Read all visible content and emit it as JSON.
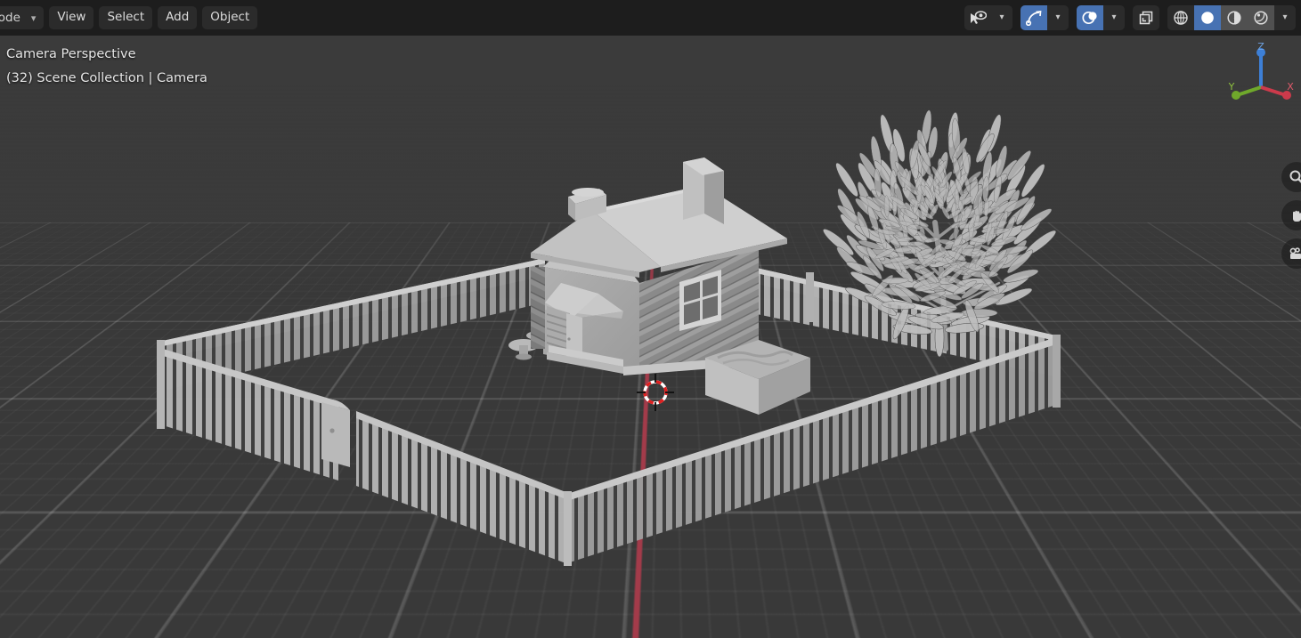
{
  "app": {
    "name": "Blender 3D Viewport",
    "editor": "3D Viewport"
  },
  "header": {
    "mode_selector": {
      "label": "lode",
      "full_label": "Object Mode",
      "chevron": "chevron-down"
    },
    "menus": [
      {
        "label": "View",
        "name": "view"
      },
      {
        "label": "Select",
        "name": "select"
      },
      {
        "label": "Add",
        "name": "add"
      },
      {
        "label": "Object",
        "name": "object"
      }
    ],
    "right_controls": [
      {
        "name": "object-type-visibility",
        "icon": "eye-cursor-icon",
        "active": false,
        "has_dropdown": true
      },
      {
        "name": "show-gizmo",
        "icon": "gizmo-arc-arrow-icon",
        "active": true,
        "has_dropdown": true
      },
      {
        "name": "show-overlays",
        "icon": "overlays-circles-icon",
        "active": true,
        "has_dropdown": true
      },
      {
        "name": "toggle-xray",
        "icon": "xray-squares-icon",
        "active": false,
        "has_dropdown": false
      }
    ],
    "shading_modes": [
      {
        "name": "wireframe",
        "icon": "wireframe-globe-icon",
        "active": false
      },
      {
        "name": "solid",
        "icon": "solid-sphere-icon",
        "active": true
      },
      {
        "name": "material-preview",
        "icon": "material-sphere-icon",
        "active": false
      },
      {
        "name": "rendered",
        "icon": "rendered-sphere-icon",
        "active": false
      }
    ],
    "shading_dropdown_chevron": "chevron-down"
  },
  "overlay_info": {
    "view_label": "Camera Perspective",
    "scene_label": "(32) Scene Collection | Camera"
  },
  "nav_gizmo": {
    "axes": [
      {
        "name": "z",
        "label": "Z",
        "color": "#3d7fd6"
      },
      {
        "name": "y",
        "label": "Y",
        "color": "#6fa82b"
      },
      {
        "name": "x",
        "label": "X",
        "color": "#cc3a4b"
      }
    ]
  },
  "side_gizmo": [
    {
      "name": "zoom-gizmo",
      "icon": "magnifier-icon"
    },
    {
      "name": "pan-gizmo",
      "icon": "hand-icon"
    },
    {
      "name": "camera-gizmo",
      "icon": "camera-icon"
    }
  ],
  "viewport": {
    "background_color": "#3b3b3b",
    "grid_color": "#545454",
    "axis_x_color": "#a33b4a",
    "axis_y_color": "#6a9b2e",
    "cursor_name": "3d-cursor",
    "objects": [
      {
        "name": "log-cabin-house",
        "label": "Log Cabin"
      },
      {
        "name": "picket-fence",
        "label": "Picket Fence"
      },
      {
        "name": "fence-gate",
        "label": "Gate"
      },
      {
        "name": "tree",
        "label": "Tree"
      },
      {
        "name": "planter-box",
        "label": "Planter Box"
      },
      {
        "name": "garden-table",
        "label": "Garden Table"
      },
      {
        "name": "chimney-front",
        "label": "Chimney"
      },
      {
        "name": "chimney-rear",
        "label": "Chimney"
      },
      {
        "name": "porch-awning",
        "label": "Porch Awning"
      },
      {
        "name": "front-door",
        "label": "Door"
      },
      {
        "name": "cabin-window",
        "label": "Window"
      }
    ]
  }
}
